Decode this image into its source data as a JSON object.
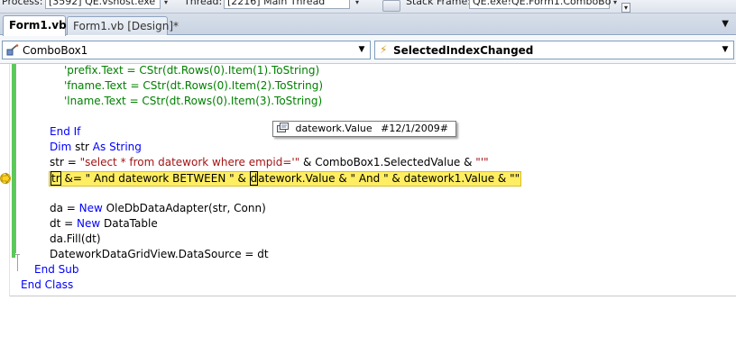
{
  "debug_toolbar": {
    "process_label": "Process:",
    "process_value": "[3592] QE.vshost.exe",
    "thread_label": "Thread:",
    "thread_value": "[2216] Main Thread",
    "stack_label": "Stack Frame:",
    "stack_value": "QE.exe!QE.Form1.ComboBo"
  },
  "tabs": [
    {
      "label": "Form1.vb*",
      "active": true
    },
    {
      "label": "Form1.vb [Design]*",
      "active": false
    }
  ],
  "navbar": {
    "object": "ComboBox1",
    "event": "SelectedIndexChanged"
  },
  "code": {
    "l1": "'prefix.Text = CStr(dt.Rows(0).Item(1).ToString)",
    "l2": "'fname.Text = CStr(dt.Rows(0).Item(2).ToString)",
    "l3": "'lname.Text = CStr(dt.Rows(0).Item(3).ToString)",
    "l5": "End If",
    "l6_kw1": "Dim",
    "l6_mid": " str ",
    "l6_kw2": "As String",
    "l7_a": "str = ",
    "l7_str1": "\"select * from datework where empid='\"",
    "l7_b": " & ComboBox1.SelectedValue & ",
    "l7_str2": "\"'\"",
    "l8_caret": "tr",
    "l8_a": " &= \" And datework BETWEEN \" & ",
    "l8_caret2": "d",
    "l8_b": "atework.Value",
    "l8_c": " & \" And \" & datework1.Value & \"\"",
    "l9_a": "da = ",
    "l9_kw": "New",
    "l9_b": " OleDbDataAdapter(str, Conn)",
    "l10_a": "dt = ",
    "l10_kw": "New",
    "l10_b": " DataTable",
    "l11": "da.Fill(dt)",
    "l12": "DateworkDataGridView.DataSource = dt",
    "l13": "End Sub",
    "l14": "End Class"
  },
  "datatip": {
    "name": "datework.Value",
    "value": "#12/1/2009#"
  },
  "colors": {
    "keyword": "#0000ff",
    "comment": "#008000",
    "string": "#a31515",
    "highlight": "#ffee62",
    "changebar": "#5cc75c"
  }
}
